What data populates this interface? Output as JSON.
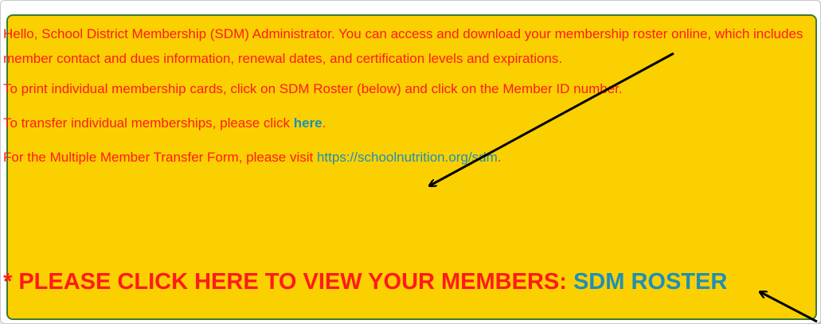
{
  "notice": {
    "intro": "Hello, School District Membership (SDM) Administrator. You can access and download your membership roster online, which includes member contact and dues information, renewal dates, and certification levels and expirations.",
    "print_cards": "To print individual membership cards, click on SDM Roster (below) and click on the Member ID number.",
    "transfer_prefix": "To transfer individual memberships, please click ",
    "transfer_link": "here",
    "transfer_suffix": ".",
    "multi_prefix": "For the Multiple Member Transfer Form, please visit ",
    "multi_link": "https://schoolnutrition.org/sdm",
    "multi_suffix": ".",
    "cta_prefix": "* PLEASE CLICK HERE TO VIEW YOUR MEMBERS: ",
    "cta_link": "SDM ROSTER"
  },
  "colors": {
    "panel_background": "#fbd000",
    "panel_border": "#3e7a2f",
    "text": "#ff1a1a",
    "link": "#1f8fb5",
    "arrow": "#000000"
  },
  "annotations": [
    {
      "name": "arrow-to-here-link",
      "icon": "arrow-icon"
    },
    {
      "name": "arrow-to-sdm-roster",
      "icon": "arrow-icon"
    }
  ]
}
